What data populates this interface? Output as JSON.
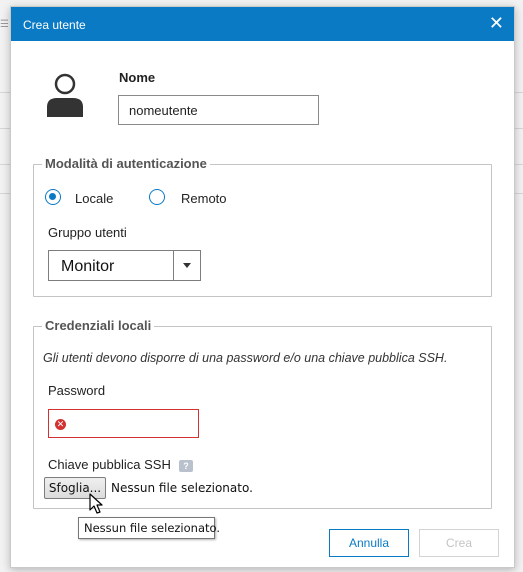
{
  "dialog": {
    "title": "Crea utente",
    "close_glyph": "✕"
  },
  "user": {
    "name_label": "Nome",
    "name_value": "nomeutente"
  },
  "auth": {
    "legend": "Modalità di autenticazione",
    "options": [
      {
        "label": "Locale",
        "selected": true
      },
      {
        "label": "Remoto",
        "selected": false
      }
    ],
    "group_label": "Gruppo utenti",
    "group_value": "Monitor"
  },
  "credentials": {
    "legend": "Credenziali locali",
    "info": "Gli utenti devono disporre di una password e/o una chiave pubblica SSH.",
    "password_label": "Password",
    "password_error": true,
    "ssh_label": "Chiave pubblica SSH",
    "help_glyph": "?",
    "error_glyph": "✕",
    "browse_label": "Sfoglia...",
    "file_status": "Nessun file selezionato.",
    "tooltip": "Nessun file selezionato."
  },
  "actions": {
    "cancel_label": "Annulla",
    "create_label": "Crea",
    "create_enabled": false
  },
  "colors": {
    "accent": "#0a7ac4",
    "error": "#d23232",
    "disabled": "#c4c4c4"
  }
}
